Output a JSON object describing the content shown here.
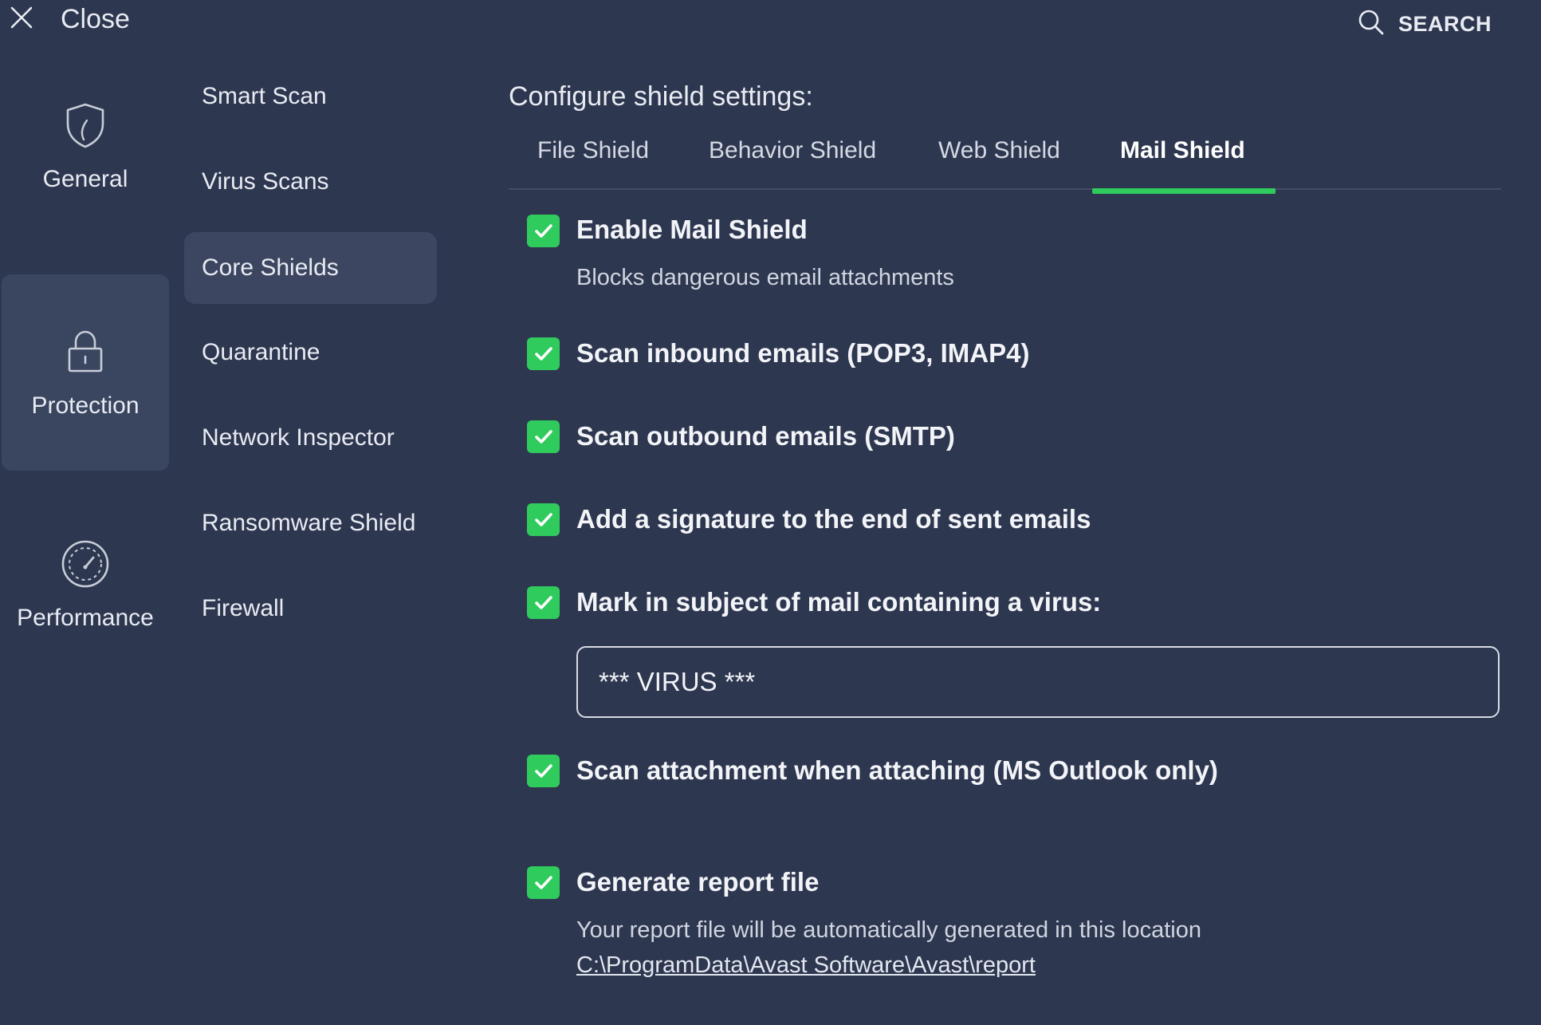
{
  "topbar": {
    "close_label": "Close",
    "search_label": "SEARCH"
  },
  "categories": [
    {
      "label": "General",
      "icon": "shield-icon"
    },
    {
      "label": "Protection",
      "icon": "lock-icon"
    },
    {
      "label": "Performance",
      "icon": "speedometer-icon"
    }
  ],
  "nav": {
    "items": [
      {
        "label": "Smart Scan"
      },
      {
        "label": "Virus Scans"
      },
      {
        "label": "Core Shields"
      },
      {
        "label": "Quarantine"
      },
      {
        "label": "Network Inspector"
      },
      {
        "label": "Ransomware Shield"
      },
      {
        "label": "Firewall"
      }
    ],
    "active": "Core Shields"
  },
  "main": {
    "title": "Configure shield settings:",
    "tabs": [
      {
        "label": "File Shield"
      },
      {
        "label": "Behavior Shield"
      },
      {
        "label": "Web Shield"
      },
      {
        "label": "Mail Shield"
      }
    ],
    "active_tab": "Mail Shield",
    "options": {
      "enable": {
        "label": "Enable Mail Shield",
        "desc": "Blocks dangerous email attachments",
        "checked": true
      },
      "inbound": {
        "label": "Scan inbound emails (POP3, IMAP4)",
        "checked": true
      },
      "outbound": {
        "label": "Scan outbound emails (SMTP)",
        "checked": true
      },
      "signature": {
        "label": "Add a signature to the end of sent emails",
        "checked": true
      },
      "mark_subject": {
        "label": "Mark in subject of mail containing a virus:",
        "checked": true,
        "value": "*** VIRUS ***"
      },
      "attachment": {
        "label": "Scan attachment when attaching (MS Outlook only)",
        "checked": true
      },
      "report": {
        "label": "Generate report file",
        "checked": true,
        "desc": "Your report file will be automatically generated in this location",
        "path": "C:\\ProgramData\\Avast Software\\Avast\\report"
      }
    }
  },
  "colors": {
    "background": "#2e3750",
    "accent": "#2fcb5c",
    "active_item": "#3d4660"
  }
}
